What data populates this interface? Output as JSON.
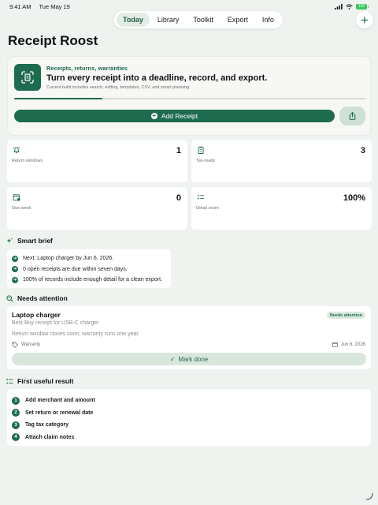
{
  "status": {
    "time": "9:41 AM",
    "date": "Tue May 19",
    "battery": "100"
  },
  "tabs": [
    {
      "label": "Today",
      "active": true
    },
    {
      "label": "Library",
      "active": false
    },
    {
      "label": "Toolkit",
      "active": false
    },
    {
      "label": "Export",
      "active": false
    },
    {
      "label": "Info",
      "active": false
    }
  ],
  "add_button": "+",
  "page_title": "Receipt Roost",
  "hero": {
    "eyebrow": "Receipts, returns, warranties",
    "headline": "Turn every receipt into a deadline, record, and export.",
    "subtitle": "Current build includes search, editing, templates, CSV, and smart planning.",
    "progress": 0.25,
    "add_receipt_label": "Add Receipt"
  },
  "stats": [
    {
      "value": "1",
      "label": "Return windows",
      "icon": "bell-icon"
    },
    {
      "value": "3",
      "label": "Tax-ready",
      "icon": "clipboard-icon"
    },
    {
      "value": "0",
      "label": "Due week",
      "icon": "calendar-icon"
    },
    {
      "value": "100%",
      "label": "Detail score",
      "icon": "checklist-icon"
    }
  ],
  "smart_brief": {
    "title": "Smart brief",
    "items": [
      "Next: Laptop charger by Jun 6, 2026.",
      "0 open receipts are due within seven days.",
      "100% of records include enough detail for a clean export."
    ]
  },
  "needs_attention": {
    "title": "Needs attention",
    "card": {
      "title": "Laptop charger",
      "badge": "Needs attention",
      "subtitle": "Best Buy receipt for USB-C charger",
      "description": "Return window closes soon; warranty runs one year.",
      "tag": "Warranty",
      "date": "Jun 6, 2026",
      "action": "Mark done"
    }
  },
  "first_result": {
    "title": "First useful result",
    "steps": [
      {
        "num": "1",
        "label": "Add merchant and amount"
      },
      {
        "num": "2",
        "label": "Set return or renewal date"
      },
      {
        "num": "3",
        "label": "Tag tax category"
      },
      {
        "num": "4",
        "label": "Attach claim notes"
      }
    ]
  },
  "colors": {
    "accent": "#1f6b4f",
    "background": "#eef3ef"
  }
}
